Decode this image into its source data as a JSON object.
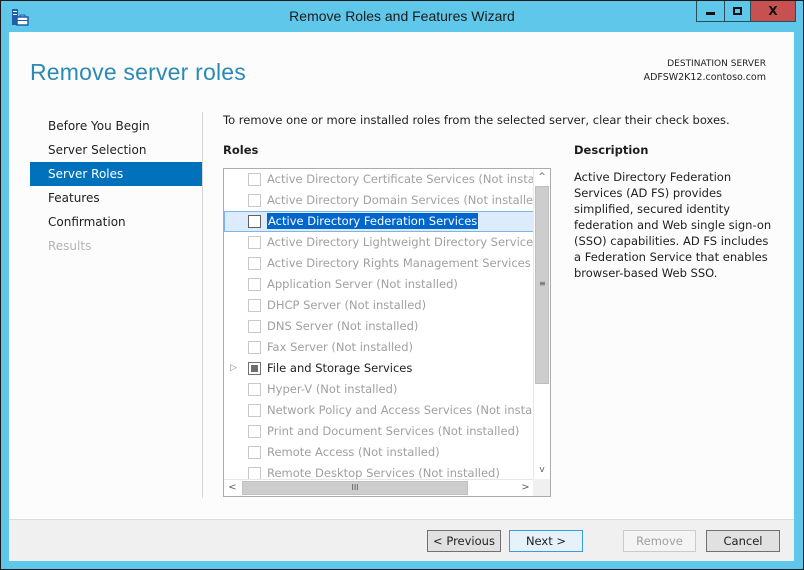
{
  "window": {
    "title": "Remove Roles and Features Wizard",
    "controls": {
      "minimize": "minimize",
      "maximize": "maximize",
      "close": "X"
    }
  },
  "header": {
    "page_title": "Remove server roles",
    "destination_label": "DESTINATION SERVER",
    "destination_server": "ADFSW2K12.contoso.com"
  },
  "nav": {
    "items": [
      {
        "label": "Before You Begin",
        "state": "normal"
      },
      {
        "label": "Server Selection",
        "state": "normal"
      },
      {
        "label": "Server Roles",
        "state": "active"
      },
      {
        "label": "Features",
        "state": "normal"
      },
      {
        "label": "Confirmation",
        "state": "normal"
      },
      {
        "label": "Results",
        "state": "disabled"
      }
    ]
  },
  "main": {
    "instructions": "To remove one or more installed roles from the selected server, clear their check boxes.",
    "roles_label": "Roles",
    "roles": [
      {
        "label": "Active Directory Certificate Services (Not installed)",
        "installed": false,
        "checked": false
      },
      {
        "label": "Active Directory Domain Services (Not installed)",
        "installed": false,
        "checked": false
      },
      {
        "label": "Active Directory Federation Services",
        "installed": true,
        "checked": false,
        "selected": true
      },
      {
        "label": "Active Directory Lightweight Directory Services (Not installed)",
        "installed": false,
        "checked": false
      },
      {
        "label": "Active Directory Rights Management Services (Not installed)",
        "installed": false,
        "checked": false
      },
      {
        "label": "Application Server (Not installed)",
        "installed": false,
        "checked": false
      },
      {
        "label": "DHCP Server (Not installed)",
        "installed": false,
        "checked": false
      },
      {
        "label": "DNS Server (Not installed)",
        "installed": false,
        "checked": false
      },
      {
        "label": "Fax Server (Not installed)",
        "installed": false,
        "checked": false
      },
      {
        "label": "File and Storage Services",
        "installed": true,
        "checked": "partial",
        "expandable": true
      },
      {
        "label": "Hyper-V (Not installed)",
        "installed": false,
        "checked": false
      },
      {
        "label": "Network Policy and Access Services (Not installed)",
        "installed": false,
        "checked": false
      },
      {
        "label": "Print and Document Services (Not installed)",
        "installed": false,
        "checked": false
      },
      {
        "label": "Remote Access (Not installed)",
        "installed": false,
        "checked": false
      },
      {
        "label": "Remote Desktop Services (Not installed)",
        "installed": false,
        "checked": false
      }
    ],
    "scroll": {
      "up": "^",
      "down": "v",
      "left": "<",
      "right": ">",
      "grip_v": "≡",
      "grip_h": "III"
    },
    "description_label": "Description",
    "description": "Active Directory Federation Services (AD FS) provides simplified, secured identity federation and Web single sign-on (SSO) capabilities. AD FS includes a Federation Service that enables browser-based Web SSO."
  },
  "footer": {
    "previous": "< Previous",
    "next": "Next >",
    "remove": "Remove",
    "cancel": "Cancel"
  }
}
